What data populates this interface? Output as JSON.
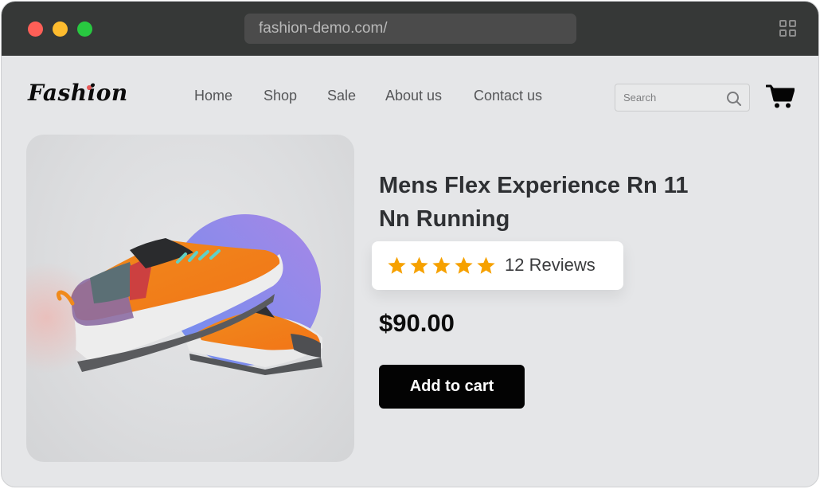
{
  "browser": {
    "url": "fashion-demo.com/",
    "traffic_lights": [
      "close",
      "minimize",
      "maximize"
    ],
    "colors": {
      "close": "#fe5f57",
      "minimize": "#febc2e",
      "maximize": "#28c840"
    }
  },
  "header": {
    "logo": "Fashion",
    "nav": [
      {
        "label": "Home"
      },
      {
        "label": "Shop"
      },
      {
        "label": "Sale"
      },
      {
        "label": "About us"
      },
      {
        "label": "Contact us"
      }
    ],
    "search": {
      "placeholder": "Search",
      "value": ""
    },
    "cart_icon": "shopping-cart-icon"
  },
  "product": {
    "title": "Mens Flex Experience Rn 11 Nn Running",
    "image_alt": "Orange running shoes with purple circle backdrop",
    "rating": {
      "stars": 5,
      "max": 5,
      "reviews_label": "12 Reviews",
      "star_color": "#f6a100"
    },
    "price": "$90.00",
    "add_to_cart_label": "Add to cart"
  }
}
